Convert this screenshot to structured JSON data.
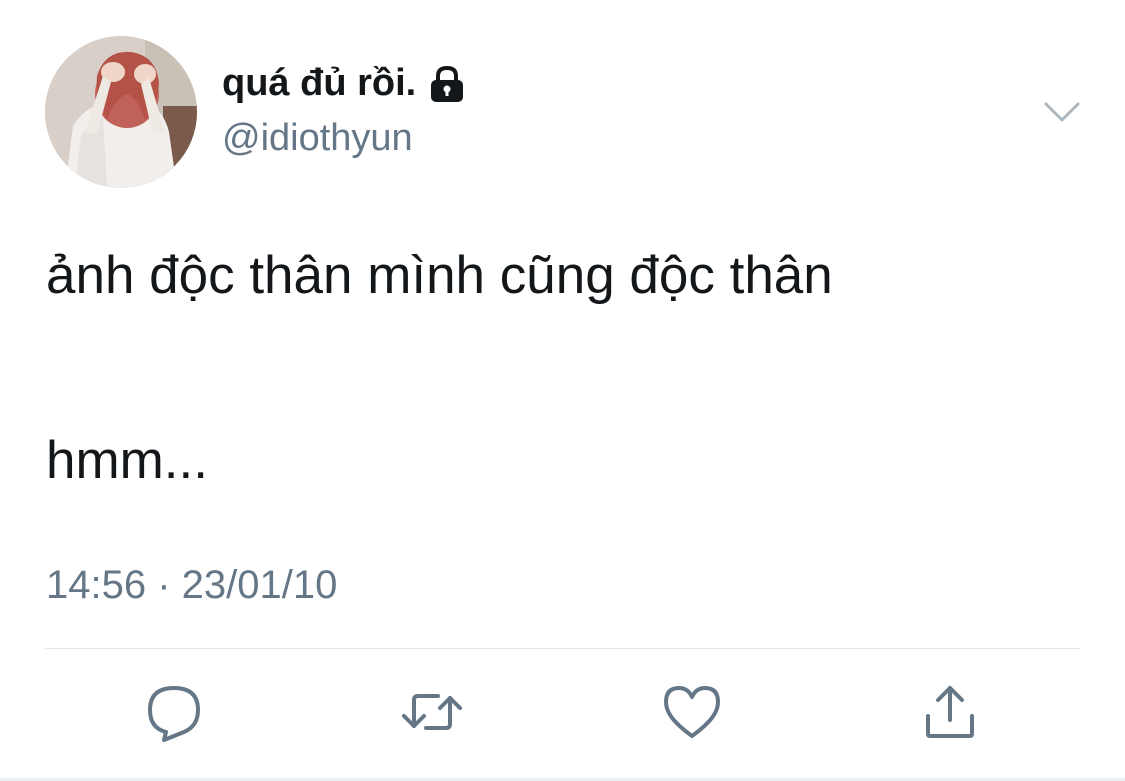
{
  "tweet": {
    "display_name": "quá đủ rồi.",
    "handle": "@idiothyun",
    "text_line_1": "ảnh độc thân mình cũng độc thân",
    "text_line_2": "hmm...",
    "timestamp": "14:56 · 23/01/10",
    "protected": true
  },
  "icons": {
    "lock": "lock-icon",
    "caret": "chevron-down-icon",
    "reply": "reply-icon",
    "retweet": "retweet-icon",
    "like": "heart-icon",
    "share": "share-icon"
  },
  "colors": {
    "text_primary": "#14171a",
    "text_secondary": "#657786",
    "icon_gray": "#657786",
    "divider": "#e1e8ed"
  }
}
